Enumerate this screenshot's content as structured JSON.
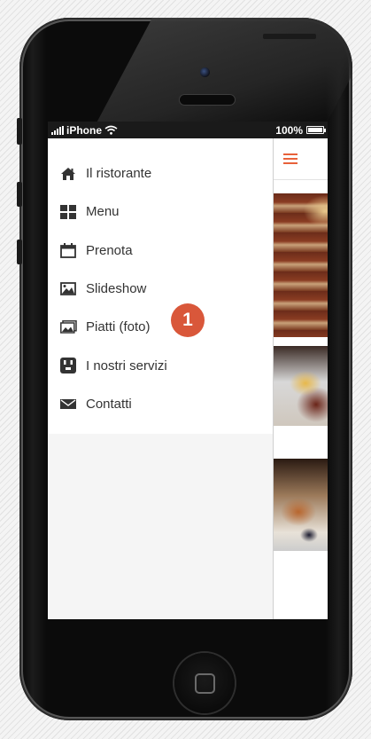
{
  "status_bar": {
    "carrier": "iPhone",
    "battery": "100%",
    "icons": [
      "signal-icon",
      "wifi-icon",
      "battery-icon"
    ]
  },
  "menu": {
    "items": [
      {
        "label": "Il ristorante",
        "icon": "home-icon"
      },
      {
        "label": "Menu",
        "icon": "grid-icon"
      },
      {
        "label": "Prenota",
        "icon": "calendar-icon"
      },
      {
        "label": "Slideshow",
        "icon": "image-icon"
      },
      {
        "label": "Piatti (foto)",
        "icon": "photos-icon"
      },
      {
        "label": "I nostri servizi",
        "icon": "services-icon"
      },
      {
        "label": "Contatti",
        "icon": "envelope-icon"
      }
    ]
  },
  "header": {
    "menu_icon": "hamburger-icon"
  },
  "annotation": {
    "badge_number": "1"
  },
  "colors": {
    "accent": "#e8613a",
    "badge": "#d9573a",
    "text": "#333333"
  }
}
